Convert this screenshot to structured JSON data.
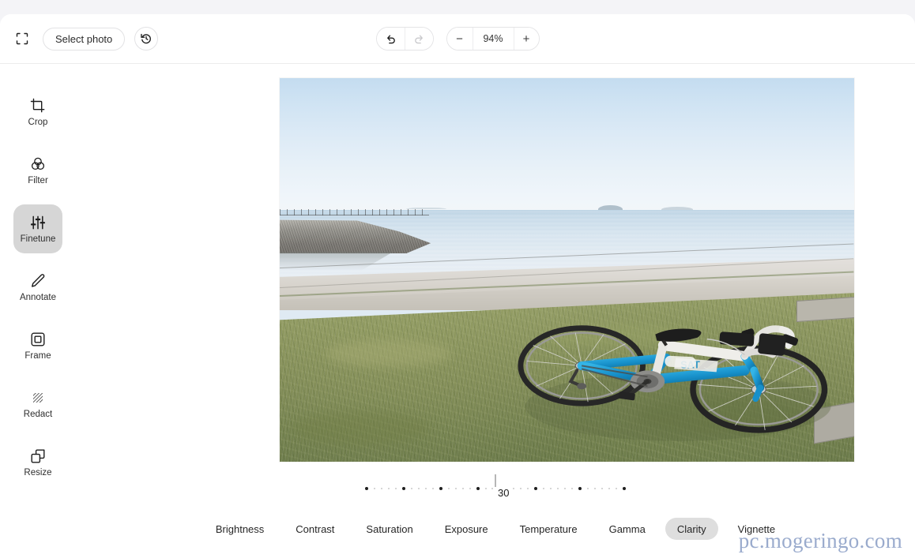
{
  "app": {
    "accent_color": "#d6d6d6",
    "panel_bg": "#ffffff",
    "page_bg": "#f4f4f7"
  },
  "topbar": {
    "fullscreen_icon": "expand-icon",
    "select_photo_label": "Select photo",
    "history_icon": "history-revert-icon",
    "undo_icon": "undo-icon",
    "redo_icon": "redo-icon",
    "zoom_out_label": "−",
    "zoom_level": "94%",
    "zoom_in_label": "+"
  },
  "sidebar": {
    "items": [
      {
        "label": "Crop",
        "icon": "crop-icon",
        "active": false
      },
      {
        "label": "Filter",
        "icon": "filter-icon",
        "active": false
      },
      {
        "label": "Finetune",
        "icon": "finetune-icon",
        "active": true
      },
      {
        "label": "Annotate",
        "icon": "pencil-icon",
        "active": false
      },
      {
        "label": "Frame",
        "icon": "frame-icon",
        "active": false
      },
      {
        "label": "Redact",
        "icon": "redact-icon",
        "active": false
      },
      {
        "label": "Resize",
        "icon": "resize-icon",
        "active": false
      }
    ]
  },
  "canvas": {
    "photo_alt": "Blue and white road bicycle lying on seaside grass with calm sea and pale blue sky",
    "photo_scene": {
      "sky_color": "#cfe3f3",
      "sea_color": "#cfe0ec",
      "grass_color": "#8d9760",
      "path_color": "#d9d5ce",
      "bike_frame_color": "#1e9fd8",
      "bike_accent_color": "#f2f2f2"
    }
  },
  "slider": {
    "value": "30",
    "name": "Clarity",
    "min": -100,
    "max": 100
  },
  "tabs": [
    {
      "label": "Brightness",
      "active": false
    },
    {
      "label": "Contrast",
      "active": false
    },
    {
      "label": "Saturation",
      "active": false
    },
    {
      "label": "Exposure",
      "active": false
    },
    {
      "label": "Temperature",
      "active": false
    },
    {
      "label": "Gamma",
      "active": false
    },
    {
      "label": "Clarity",
      "active": true
    },
    {
      "label": "Vignette",
      "active": false
    }
  ],
  "watermark": {
    "text": "pc.mogeringo.com",
    "color": "#9aabcd"
  }
}
